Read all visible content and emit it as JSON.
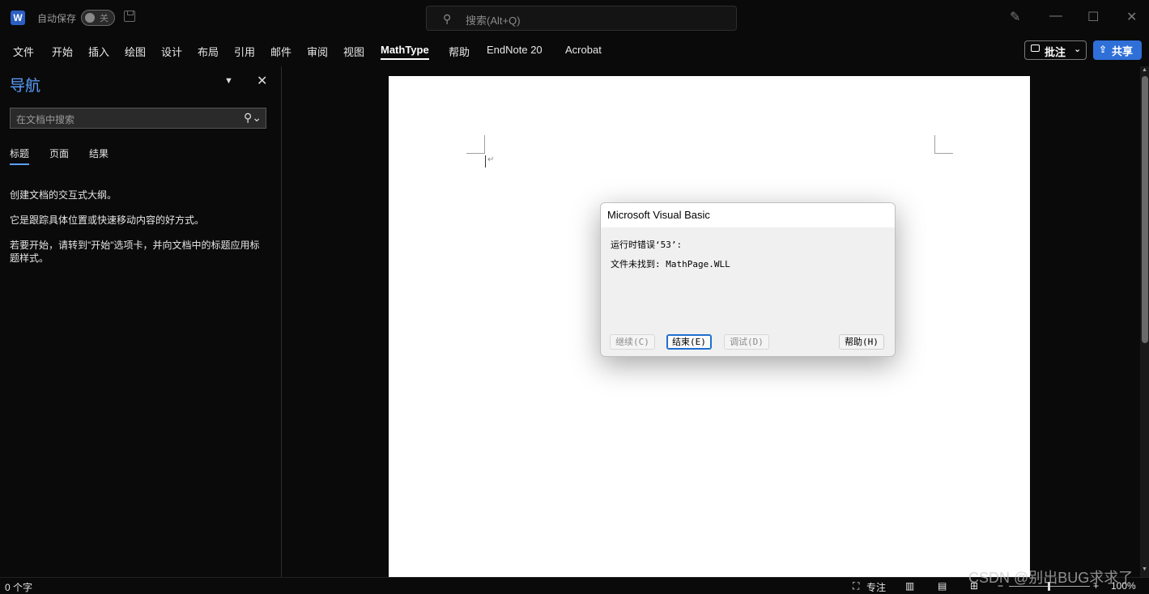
{
  "titlebar": {
    "app_icon_letter": "W",
    "autosave_label": "自动保存",
    "autosave_state": "关",
    "search_placeholder": "搜索(Alt+Q)",
    "window_buttons": [
      "minimize-icon",
      "maximize-icon",
      "close-icon"
    ]
  },
  "ribbon": {
    "tabs": [
      {
        "label": "文件"
      },
      {
        "label": "开始"
      },
      {
        "label": "插入"
      },
      {
        "label": "绘图"
      },
      {
        "label": "设计"
      },
      {
        "label": "布局"
      },
      {
        "label": "引用"
      },
      {
        "label": "邮件"
      },
      {
        "label": "审阅"
      },
      {
        "label": "视图"
      },
      {
        "label": "MathType"
      },
      {
        "label": "帮助"
      },
      {
        "label": "EndNote 20"
      },
      {
        "label": "Acrobat"
      }
    ],
    "active_tab": "MathType",
    "comments_label": "批注",
    "share_label": "共享",
    "share_color": "#2f6fd8"
  },
  "navigation": {
    "title": "导航",
    "search_placeholder": "在文档中搜索",
    "tabs": [
      {
        "label": "标题"
      },
      {
        "label": "页面"
      },
      {
        "label": "结果"
      }
    ],
    "active_tab": "标题",
    "messages": [
      "创建文档的交互式大纲。",
      "它是跟踪具体位置或快速移动内容的好方式。",
      "若要开始，请转到\"开始\"选项卡，并向文档中的标题应用标题样式。"
    ],
    "accent_color": "#5aa0ff"
  },
  "dialog": {
    "title": "Microsoft Visual Basic",
    "error_line": "运行时错误‘53’:",
    "detail_line": "文件未找到: MathPage.WLL",
    "buttons": {
      "continue": "继续(C)",
      "end": "结束(E)",
      "debug": "调试(D)",
      "help": "帮助(H)"
    }
  },
  "statusbar": {
    "word_count": "0 个字",
    "focus_label": "专注",
    "zoom_level": "100%",
    "zoom_minus": "−",
    "zoom_plus": "+"
  },
  "watermark": "CSDN @别出BUG求求了"
}
